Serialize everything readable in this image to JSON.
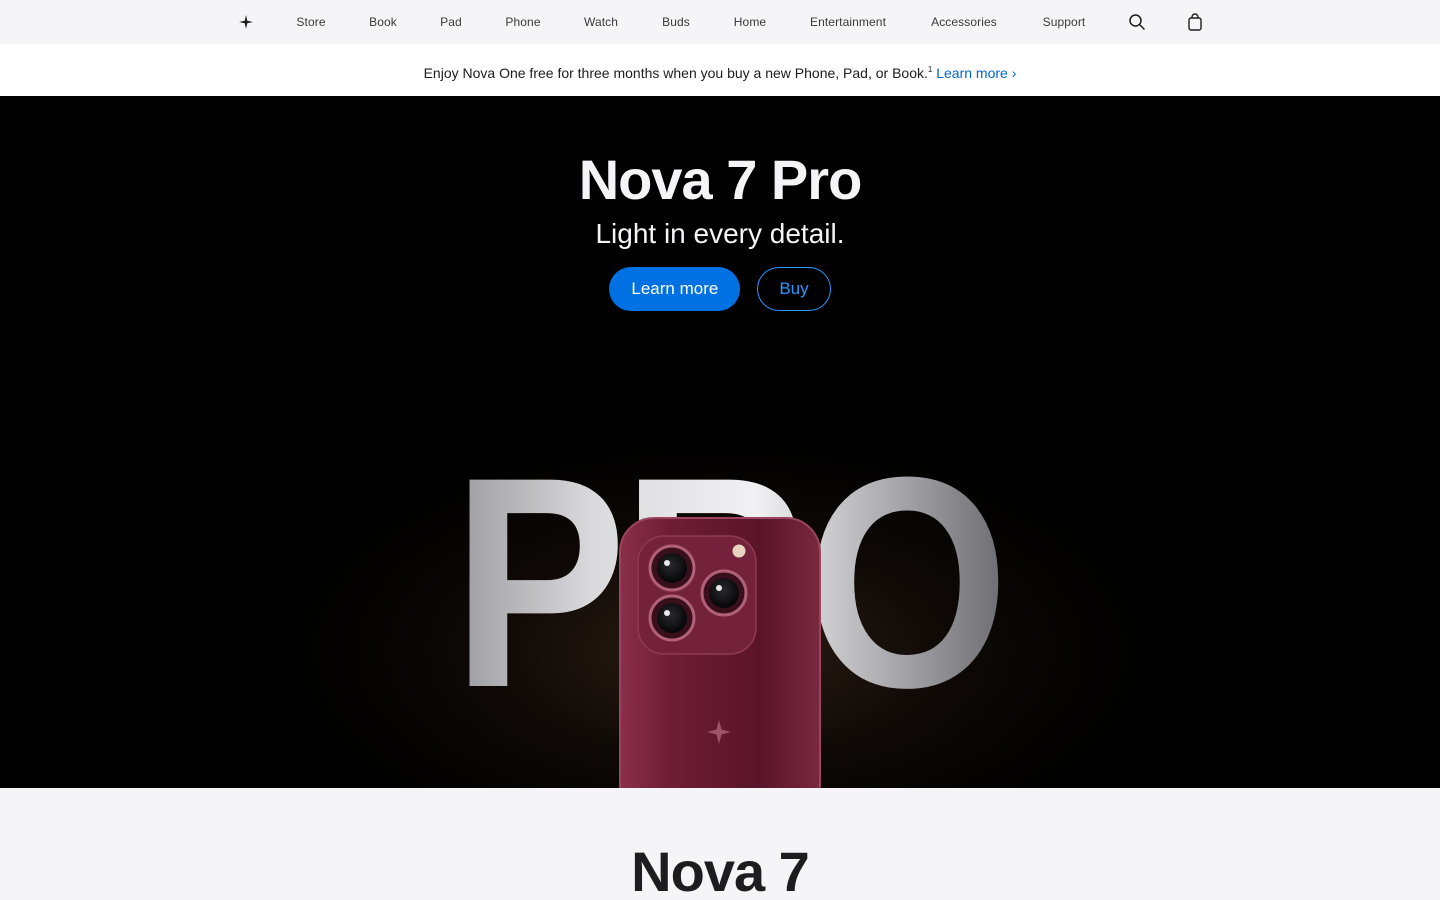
{
  "nav": {
    "logo_icon": "star-logo-icon",
    "items": [
      {
        "label": "Store"
      },
      {
        "label": "Book"
      },
      {
        "label": "Pad"
      },
      {
        "label": "Phone"
      },
      {
        "label": "Watch"
      },
      {
        "label": "Buds"
      },
      {
        "label": "Home"
      },
      {
        "label": "Entertainment"
      },
      {
        "label": "Accessories"
      },
      {
        "label": "Support"
      }
    ],
    "search_icon": "search-icon",
    "bag_icon": "shopping-bag-icon"
  },
  "ribbon": {
    "text": "Enjoy Nova One free for three months when you buy a new Phone, Pad, or Book.",
    "footnote": "1",
    "link_label": "Learn more ›"
  },
  "hero": {
    "title": "Nova 7 Pro",
    "subtitle": "Light in every detail.",
    "primary_cta": "Learn more",
    "secondary_cta": "Buy",
    "art_word": "PRO"
  },
  "next_section": {
    "title": "Nova 7"
  },
  "colors": {
    "nav_bg": "#f5f5f7",
    "text": "#1d1d1f",
    "link": "#0066cc",
    "accent": "#0071e3",
    "accent_outline": "#2997ff",
    "hero_bg": "#000000",
    "phone_body": "#6e1d35"
  }
}
